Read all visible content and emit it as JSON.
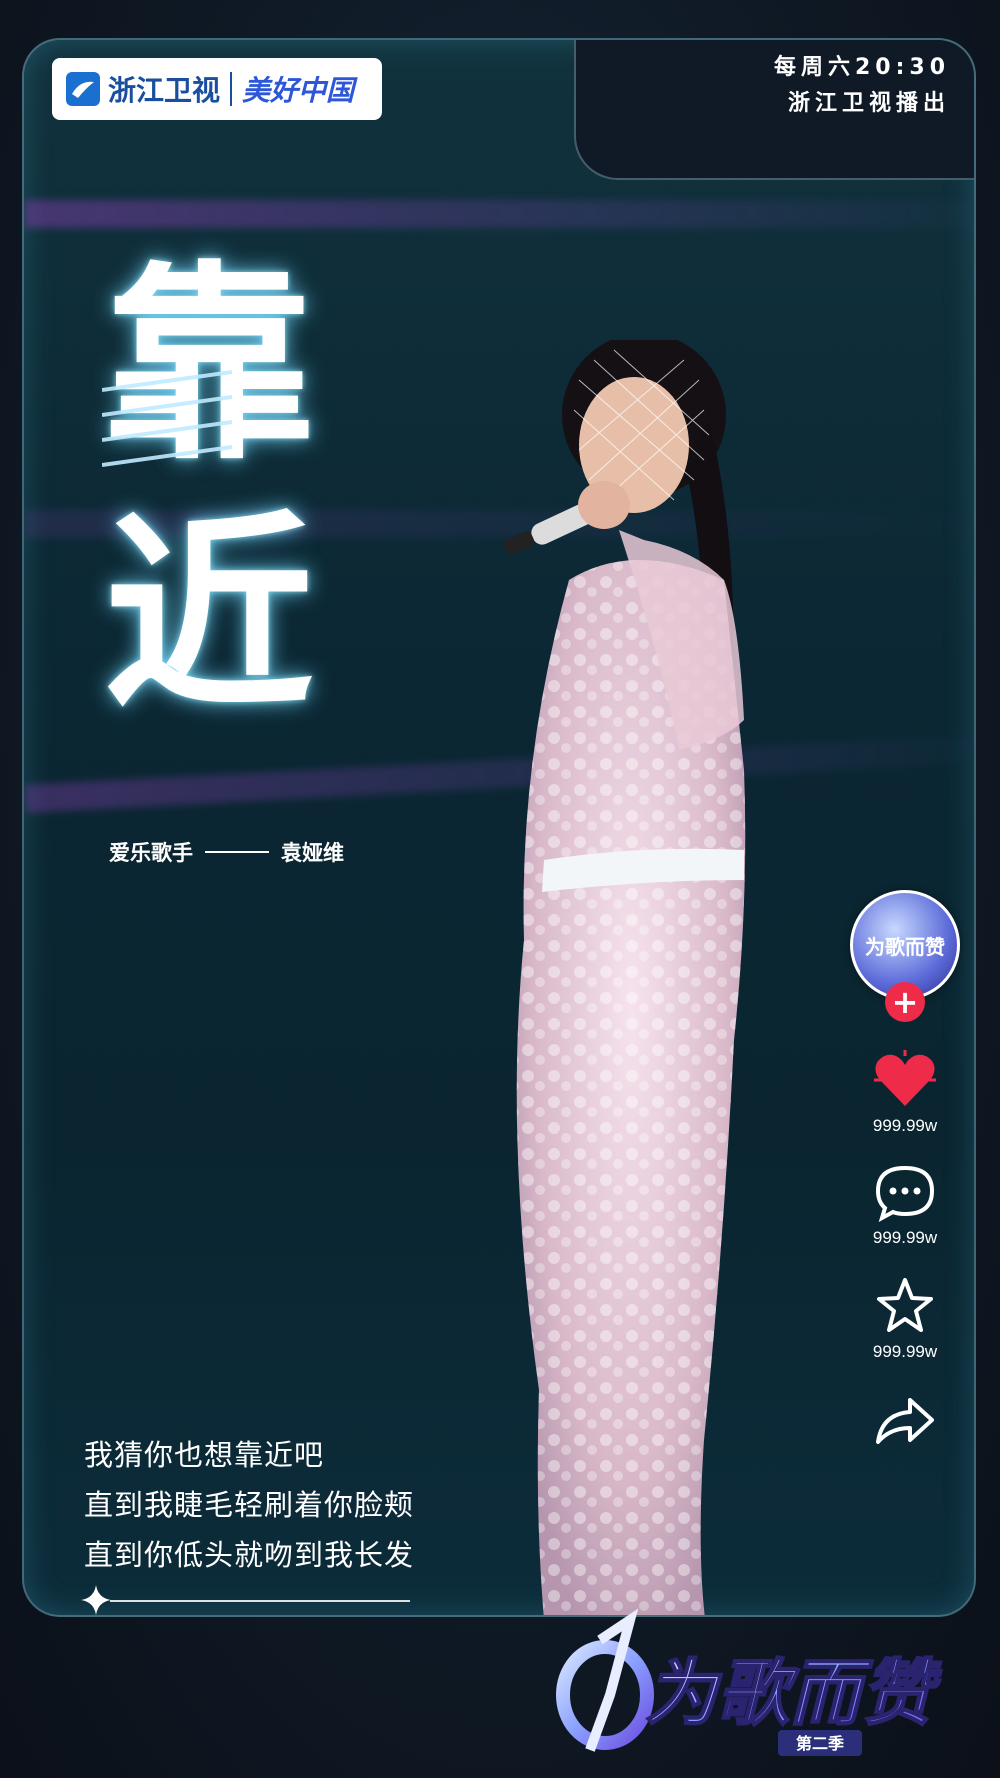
{
  "header": {
    "channel_logo": "浙江卫视",
    "slogan": "美好中国",
    "schedule_line1": "每周六20:30",
    "schedule_line2": "浙江卫视播出"
  },
  "song": {
    "title_char1": "靠",
    "title_char2": "近",
    "singer_prefix": "爱乐歌手",
    "singer_name": "袁娅维"
  },
  "lyrics": {
    "line1": "我猜你也想靠近吧",
    "line2": "直到我睫毛轻刷着你脸颊",
    "line3": "直到你低头就吻到我长发"
  },
  "actions": {
    "avatar_label": "为歌而赞",
    "follow_symbol": "+",
    "likes": "999.99w",
    "comments": "999.99w",
    "favorites": "999.99w"
  },
  "show": {
    "name": "为歌而赞",
    "season": "第二季"
  },
  "colors": {
    "accent_red": "#ef2b4a",
    "glow_cyan": "#78dcff",
    "card_bg": "#0b2733"
  },
  "icons": [
    "zhejiang-tv-logo-icon",
    "heart-icon",
    "comment-icon",
    "star-icon",
    "share-icon",
    "sparkle-icon"
  ]
}
